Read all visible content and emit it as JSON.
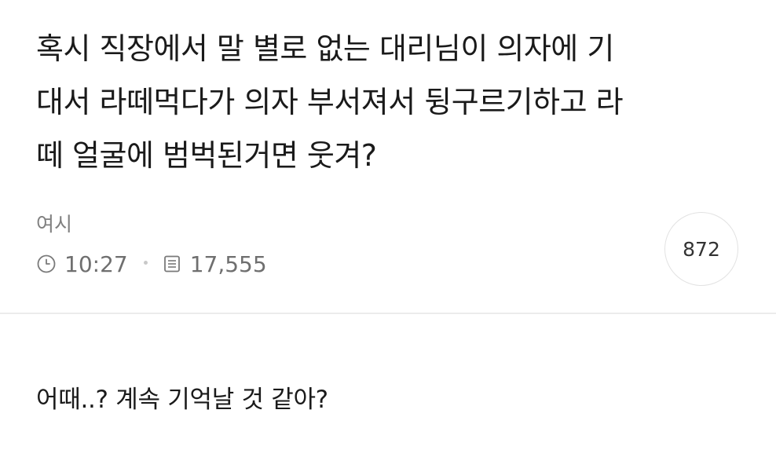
{
  "post": {
    "title": "혹시 직장에서 말 별로 없는 대리님이 의자에 기\n대서 라떼먹다가 의자 부서져서 뒹구르기하고 라\n떼 얼굴에 범벅된거면 웃겨?",
    "author": "여시",
    "time": "10:27",
    "views": "17,555",
    "comment_count": "872",
    "body": "어때..? 계속 기억날 것 같아?"
  },
  "icons": {
    "time": "clock-icon",
    "views": "document-list-icon"
  }
}
